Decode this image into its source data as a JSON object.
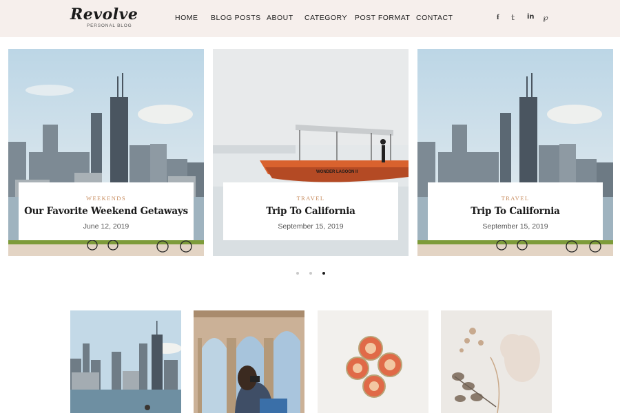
{
  "header": {
    "logo_title": "Revolve",
    "logo_subtitle": "PERSONAL BLOG",
    "nav": [
      "HOME",
      "BLOG POSTS",
      "ABOUT",
      "CATEGORY",
      "POST FORMAT",
      "CONTACT"
    ],
    "social_icons": [
      "facebook-icon",
      "twitter-icon",
      "linkedin-icon",
      "pinterest-icon"
    ],
    "social_glyphs": [
      "f",
      "𝕥",
      "in",
      "℘"
    ]
  },
  "slider": {
    "slides": [
      {
        "category": "WEEKENDS",
        "title": "Our Favorite Weekend Getaways",
        "date": "June 12, 2019",
        "image": "city-skyline"
      },
      {
        "category": "TRAVEL",
        "title": "Trip To California",
        "date": "September 15, 2019",
        "image": "boat-lagoon"
      },
      {
        "category": "TRAVEL",
        "title": "Trip To California",
        "date": "September 15, 2019",
        "image": "city-skyline"
      }
    ],
    "boat_name": "WONDER LAGOON II",
    "active_dot": 3,
    "dot_count": 3
  },
  "thumbnails": [
    {
      "image": "city-skyline-thumb"
    },
    {
      "image": "arches-photographer"
    },
    {
      "image": "figs"
    },
    {
      "image": "dried-flowers"
    }
  ],
  "colors": {
    "header_bg": "#f6efec",
    "accent": "#c68a5c",
    "text_dark": "#1b1b1b"
  }
}
